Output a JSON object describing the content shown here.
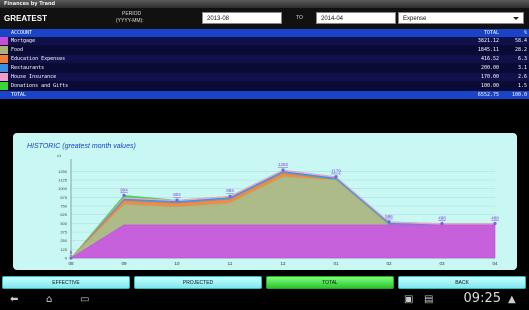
{
  "window": {
    "title": "Finances by Trand"
  },
  "header": {
    "app_name": "GREATEST",
    "period_label": "PERIOD",
    "period_format": "(YYYY-MM):",
    "from_value": "2013-08",
    "to_label": "TO",
    "to_value": "2014-04",
    "type_value": "Expense"
  },
  "table": {
    "columns": {
      "account": "ACCOUNT",
      "total": "TOTAL",
      "pct": "%"
    },
    "rows": [
      {
        "name": "Mortgage",
        "amount": "3821.12",
        "pct": "58.4",
        "color": "#c64fd8"
      },
      {
        "name": "Food",
        "amount": "1845.11",
        "pct": "28.2",
        "color": "#a9b47c"
      },
      {
        "name": "Education Expenses",
        "amount": "416.52",
        "pct": "6.3",
        "color": "#f07f35"
      },
      {
        "name": "Restaurants",
        "amount": "200.00",
        "pct": "3.1",
        "color": "#3c8ee0"
      },
      {
        "name": "House Insurance",
        "amount": "170.00",
        "pct": "2.6",
        "color": "#f0a0c8"
      },
      {
        "name": "Donations and Gifts",
        "amount": "100.00",
        "pct": "1.5",
        "color": "#3ad43a"
      }
    ],
    "total": {
      "label": "TOTAL",
      "amount": "6552.75",
      "pct": "100.0"
    }
  },
  "chart_data": {
    "type": "area",
    "title": "HISTORIC (greatest month values)",
    "y_unit": "x1",
    "categories": [
      "08",
      "09",
      "10",
      "11",
      "12",
      "01",
      "02",
      "03",
      "04"
    ],
    "ylim": [
      0,
      1400
    ],
    "yticks": [
      0,
      125,
      250,
      375,
      500,
      625,
      750,
      875,
      1000,
      1125,
      1250
    ],
    "series": [
      {
        "name": "Mortgage",
        "color": "#c64fd8",
        "values": [
          0,
          477,
          477,
          477,
          477,
          477,
          477,
          477,
          477
        ]
      },
      {
        "name": "Food",
        "color": "#a9b47c",
        "values": [
          0,
          297,
          260,
          317,
          695,
          650,
          0,
          0,
          0
        ]
      },
      {
        "name": "Education Expenses",
        "color": "#f07f35",
        "values": [
          0,
          52,
          52,
          52,
          52,
          0,
          0,
          0,
          0
        ]
      },
      {
        "name": "Restaurants",
        "color": "#3c8ee0",
        "values": [
          0,
          25,
          25,
          25,
          25,
          25,
          25,
          0,
          0
        ]
      },
      {
        "name": "House Insurance",
        "color": "#f0a0c8",
        "values": [
          0,
          21,
          21,
          21,
          21,
          21,
          21,
          21,
          21
        ]
      },
      {
        "name": "Donations and Gifts",
        "color": "#3ad43a",
        "values": [
          0,
          32,
          0,
          0,
          0,
          0,
          0,
          0,
          0
        ]
      }
    ],
    "point_labels": [
      "0",
      "904",
      "804",
      "893",
      "1262",
      "1179",
      "596",
      "498",
      "498"
    ]
  },
  "buttons": [
    {
      "label": "EFFECTIVE",
      "active": false
    },
    {
      "label": "PROJECTED",
      "active": false
    },
    {
      "label": "TOTAL",
      "active": true
    },
    {
      "label": "BACK",
      "active": false
    }
  ],
  "status": {
    "time": "09:25"
  }
}
